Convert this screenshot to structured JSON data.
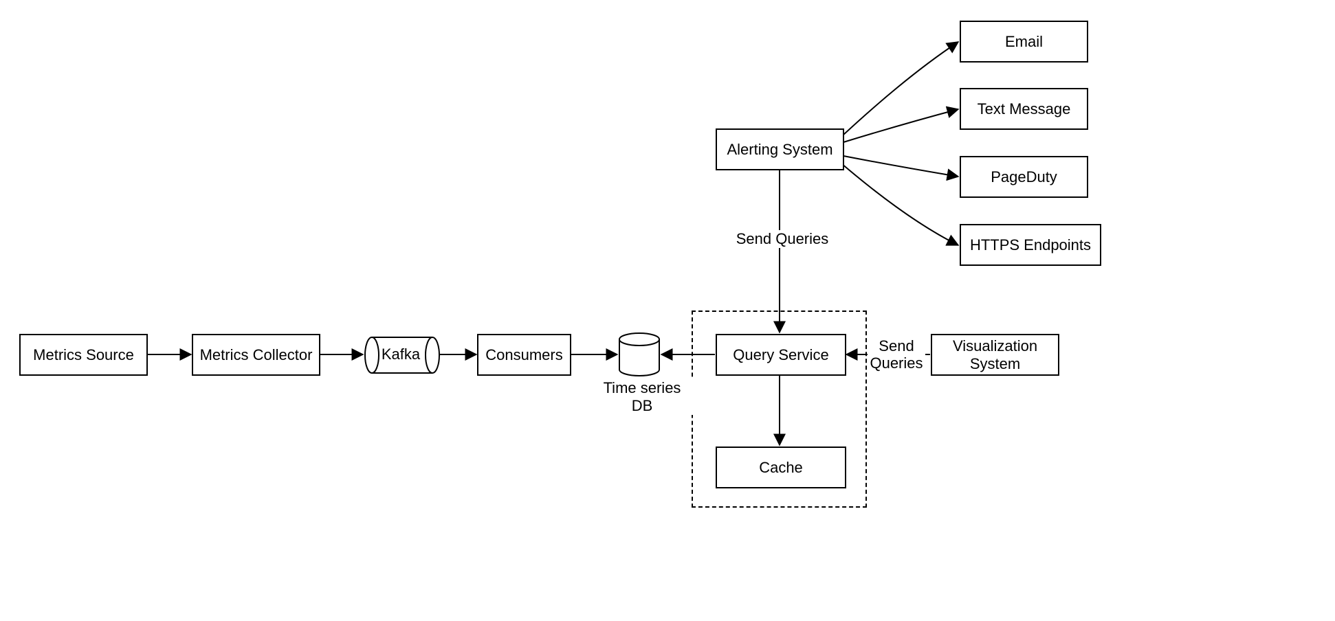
{
  "nodes": {
    "metrics_source": "Metrics Source",
    "metrics_collector": "Metrics Collector",
    "kafka": "Kafka",
    "consumers": "Consumers",
    "time_series_db": "Time series DB",
    "query_service": "Query Service",
    "cache": "Cache",
    "alerting_system": "Alerting System",
    "visualization_system": "Visualization System",
    "email": "Email",
    "text_message": "Text Message",
    "pageduty": "PageDuty",
    "https_endpoints": "HTTPS Endpoints"
  },
  "edge_labels": {
    "send_queries_top": "Send Queries",
    "send_queries_right_line1": "Send",
    "send_queries_right_line2": "Queries"
  }
}
